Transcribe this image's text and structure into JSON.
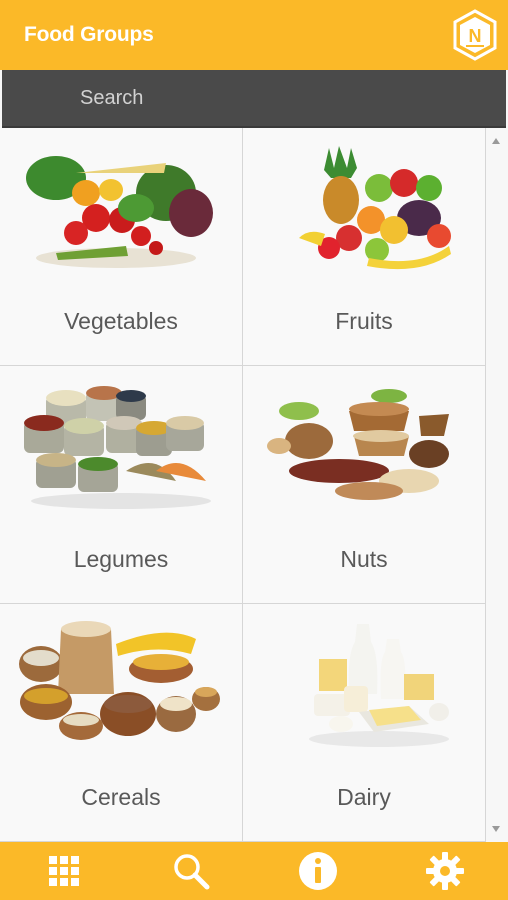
{
  "header": {
    "title": "Food Groups",
    "logo_icon": "app-logo-icon"
  },
  "search": {
    "placeholder": "Search",
    "value": ""
  },
  "food_groups": [
    {
      "label": "Vegetables",
      "icon": "vegetables-image"
    },
    {
      "label": "Fruits",
      "icon": "fruits-image"
    },
    {
      "label": "Legumes",
      "icon": "legumes-image"
    },
    {
      "label": "Nuts",
      "icon": "nuts-image"
    },
    {
      "label": "Cereals",
      "icon": "cereals-image"
    },
    {
      "label": "Dairy",
      "icon": "dairy-image"
    }
  ],
  "bottom_nav": [
    {
      "icon": "grid-icon"
    },
    {
      "icon": "search-icon"
    },
    {
      "icon": "info-icon"
    },
    {
      "icon": "gear-icon"
    }
  ],
  "colors": {
    "accent": "#fbb928",
    "search_bg": "#4a4a4a",
    "nav_icon": "#ffffff",
    "label_text": "#595959"
  }
}
